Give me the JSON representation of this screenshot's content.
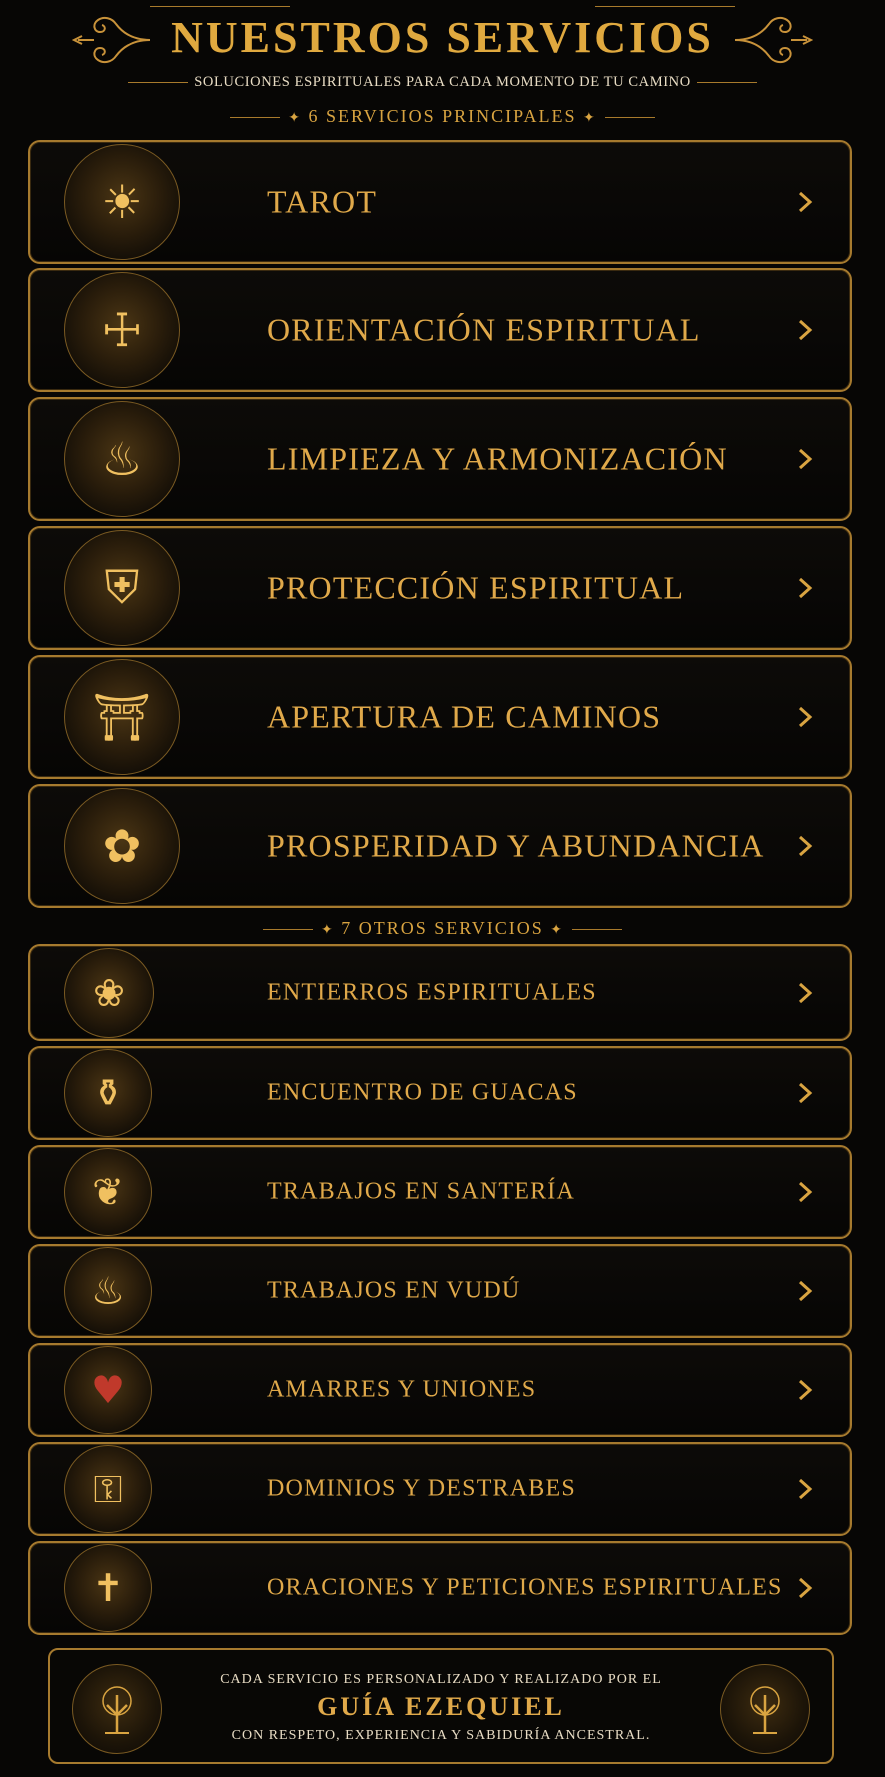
{
  "header": {
    "title": "NUESTROS SERVICIOS",
    "subtitle": "SOLUCIONES ESPIRITUALES PARA CADA MOMENTO DE TU CAMINO"
  },
  "sections": {
    "main_label": "6 SERVICIOS PRINCIPALES",
    "other_label": "7 OTROS SERVICIOS"
  },
  "main_services": [
    {
      "label": "TAROT",
      "icon": "tarot-cards-icon"
    },
    {
      "label": "ORIENTACIÓN ESPIRITUAL",
      "icon": "spiritual-guide-icon"
    },
    {
      "label": "LIMPIEZA Y ARMONIZACIÓN",
      "icon": "incense-bowl-icon"
    },
    {
      "label": "PROTECCIÓN ESPIRITUAL",
      "icon": "angel-shield-icon"
    },
    {
      "label": "APERTURA DE CAMINOS",
      "icon": "glowing-door-icon"
    },
    {
      "label": "PROSPERIDAD Y ABUNDANCIA",
      "icon": "golden-tree-icon"
    }
  ],
  "other_services": [
    {
      "label": "ENTIERROS ESPIRITUALES",
      "icon": "candles-flowers-icon"
    },
    {
      "label": "ENCUENTRO DE GUACAS",
      "icon": "treasure-jar-icon"
    },
    {
      "label": "TRABAJOS EN SANTERÍA",
      "icon": "shell-candle-icon"
    },
    {
      "label": "TRABAJOS EN VUDÚ",
      "icon": "ritual-bowl-icon"
    },
    {
      "label": "AMARRES Y UNIONES",
      "icon": "red-cord-candles-icon"
    },
    {
      "label": "DOMINIOS Y DESTRABES",
      "icon": "padlock-key-icon"
    },
    {
      "label": "ORACIONES Y PETICIONES ESPIRITUALES",
      "icon": "praying-hands-icon"
    }
  ],
  "footer": {
    "line1": "CADA SERVICIO ES PERSONALIZADO Y REALIZADO POR EL",
    "name": "GUÍA EZEQUIEL",
    "line2": "CON RESPETO, EXPERIENCIA Y SABIDURÍA ANCESTRAL.",
    "icon": "tree-of-life-icon"
  },
  "colors": {
    "background": "#070605",
    "gold": "#d9a441",
    "border": "#a67a2e",
    "text_light": "#e8dcc4"
  }
}
